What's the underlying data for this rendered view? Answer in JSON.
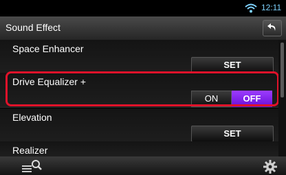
{
  "status": {
    "time": "12:11"
  },
  "header": {
    "title": "Sound Effect"
  },
  "rows": [
    {
      "label": "Space Enhancer",
      "button": "SET"
    },
    {
      "label": "Drive Equalizer +",
      "on": "ON",
      "off": "OFF",
      "selected": "OFF"
    },
    {
      "label": "Elevation",
      "button": "SET"
    },
    {
      "label": "Realizer"
    }
  ],
  "colors": {
    "highlight": "#e0122a",
    "selected_toggle": "#8a2be2",
    "clock": "#7fd3ff"
  },
  "icons": {
    "wifi": "wifi-icon",
    "back": "back-arrow-icon",
    "find": "search-list-icon",
    "settings": "gear-icon"
  }
}
